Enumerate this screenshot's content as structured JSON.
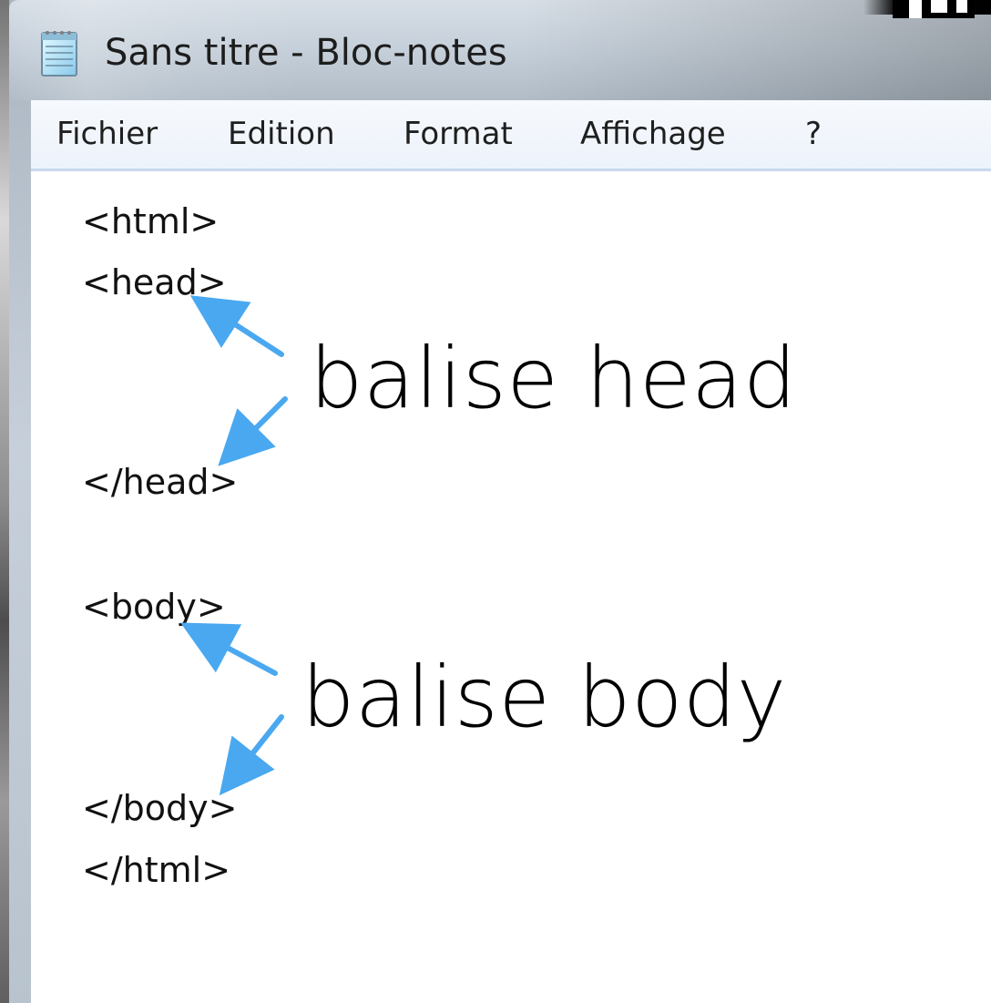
{
  "window": {
    "title": "Sans titre - Bloc-notes"
  },
  "menu": {
    "items": [
      "Fichier",
      "Edition",
      "Format",
      "Affichage",
      "?"
    ]
  },
  "editor": {
    "lines": [
      "<html>",
      "<head>",
      "</head>",
      "<body>",
      "</body>",
      "</html>"
    ]
  },
  "annotations": {
    "head": "balise head",
    "body": "balise body"
  },
  "colors": {
    "arrow": "#4aa8f0",
    "menu_background": "#edf3fb",
    "editor_background": "#ffffff"
  },
  "icons": {
    "app": "notepad-icon"
  }
}
